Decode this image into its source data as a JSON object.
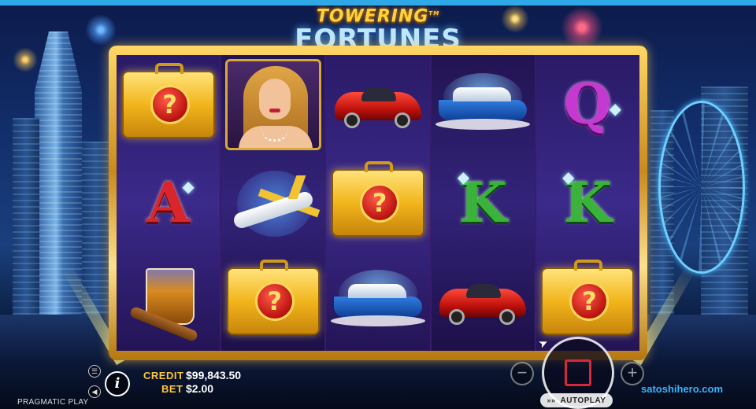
{
  "game": {
    "title_line1": "TOWERING",
    "title_tm": "TM",
    "title_line2": "FORTUNES"
  },
  "reels": [
    [
      "mystery-case",
      "letter-a",
      "whisky-cigar"
    ],
    [
      "woman-portrait",
      "jet-plane",
      "mystery-case"
    ],
    [
      "red-sports-car",
      "mystery-case",
      "blue-yacht"
    ],
    [
      "blue-yacht",
      "letter-k",
      "red-sports-car"
    ],
    [
      "letter-q",
      "letter-k",
      "mystery-case"
    ]
  ],
  "symbols": {
    "mystery_glyph": "?",
    "letter_a": "A",
    "letter_k": "K",
    "letter_q": "Q",
    "gem": "◆"
  },
  "hud": {
    "credit_label": "CREDIT",
    "credit_value": "$99,843.50",
    "bet_label": "BET",
    "bet_value": "$2.00",
    "info_label": "i",
    "menu_icon": "☰",
    "sound_icon": "◀",
    "minus_label": "−",
    "plus_label": "+",
    "autoplay_label": "AUTOPLAY",
    "autoplay_arrows": "»»",
    "provider": "PRAGMATIC PLAY"
  },
  "watermark": "satoshihero.com",
  "colors": {
    "frame_gold": "#d9a83a",
    "reel_purple": "#3b2a8a",
    "credit_label": "#ffc83a",
    "watermark": "#39b4ff",
    "stop_square": "#d22a3a"
  }
}
